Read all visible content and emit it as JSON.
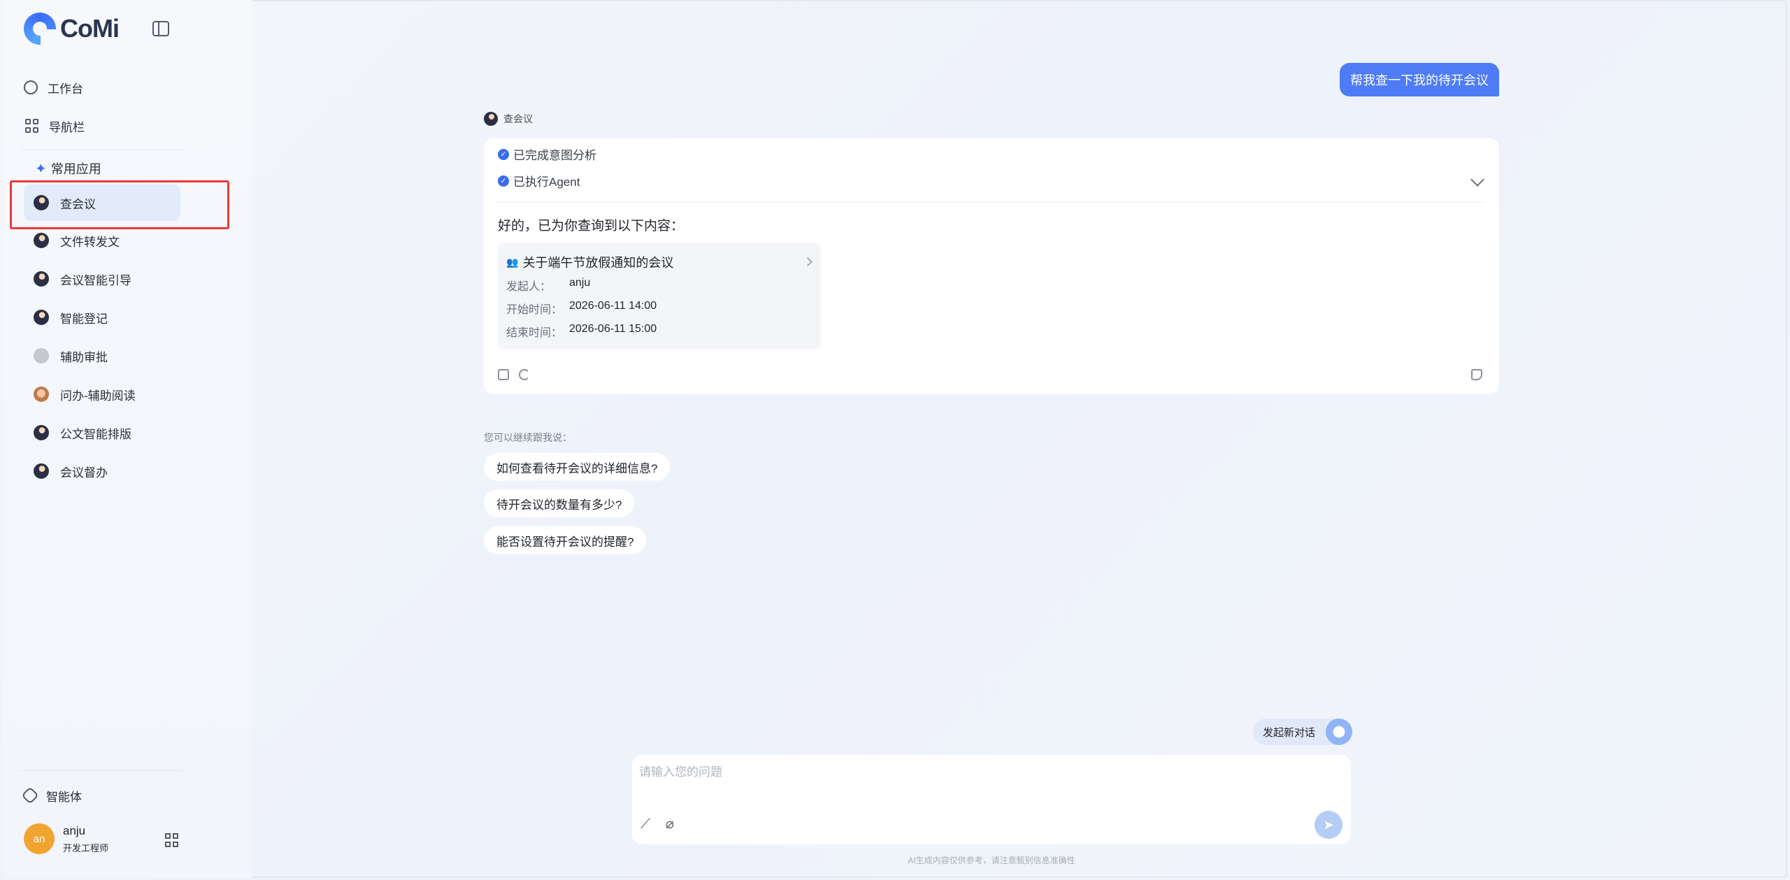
{
  "brand": {
    "name": "CoMi"
  },
  "sidebar": {
    "nav": [
      {
        "label": "工作台"
      },
      {
        "label": "导航栏"
      }
    ],
    "section_title": "常用应用",
    "apps": [
      {
        "label": "查会议"
      },
      {
        "label": "文件转发文"
      },
      {
        "label": "会议智能引导"
      },
      {
        "label": "智能登记"
      },
      {
        "label": "辅助审批"
      },
      {
        "label": "问办-辅助阅读"
      },
      {
        "label": "公文智能排版"
      },
      {
        "label": "会议督办"
      }
    ],
    "agent_label": "智能体",
    "user": {
      "avatar_text": "an",
      "name": "anju",
      "role": "开发工程师"
    }
  },
  "chat": {
    "user_message": "帮我查一下我的待开会议",
    "agent_name": "查会议",
    "steps": [
      "已完成意图分析",
      "已执行Agent"
    ],
    "intro": "好的，已为你查询到以下内容：",
    "meeting": {
      "title": "关于端午节放假通知的会议",
      "rows": [
        {
          "key": "发起人：",
          "value": "anju"
        },
        {
          "key": "开始时间：",
          "value": "2026-06-11 14:00"
        },
        {
          "key": "结束时间：",
          "value": "2026-06-11 15:00"
        }
      ]
    },
    "suggest_label": "您可以继续跟我说：",
    "suggestions": [
      "如何查看待开会议的详细信息?",
      "待开会议的数量有多少?",
      "能否设置待开会议的提醒?"
    ]
  },
  "composer": {
    "new_chat_label": "发起新对话",
    "placeholder": "请输入您的问题",
    "disclaimer": "AI生成内容仅供参考，请注意甄别信息准确性"
  },
  "colors": {
    "accent": "#4d7cf6",
    "highlight": "#ea3a3a",
    "user_avatar": "#f2a431"
  }
}
